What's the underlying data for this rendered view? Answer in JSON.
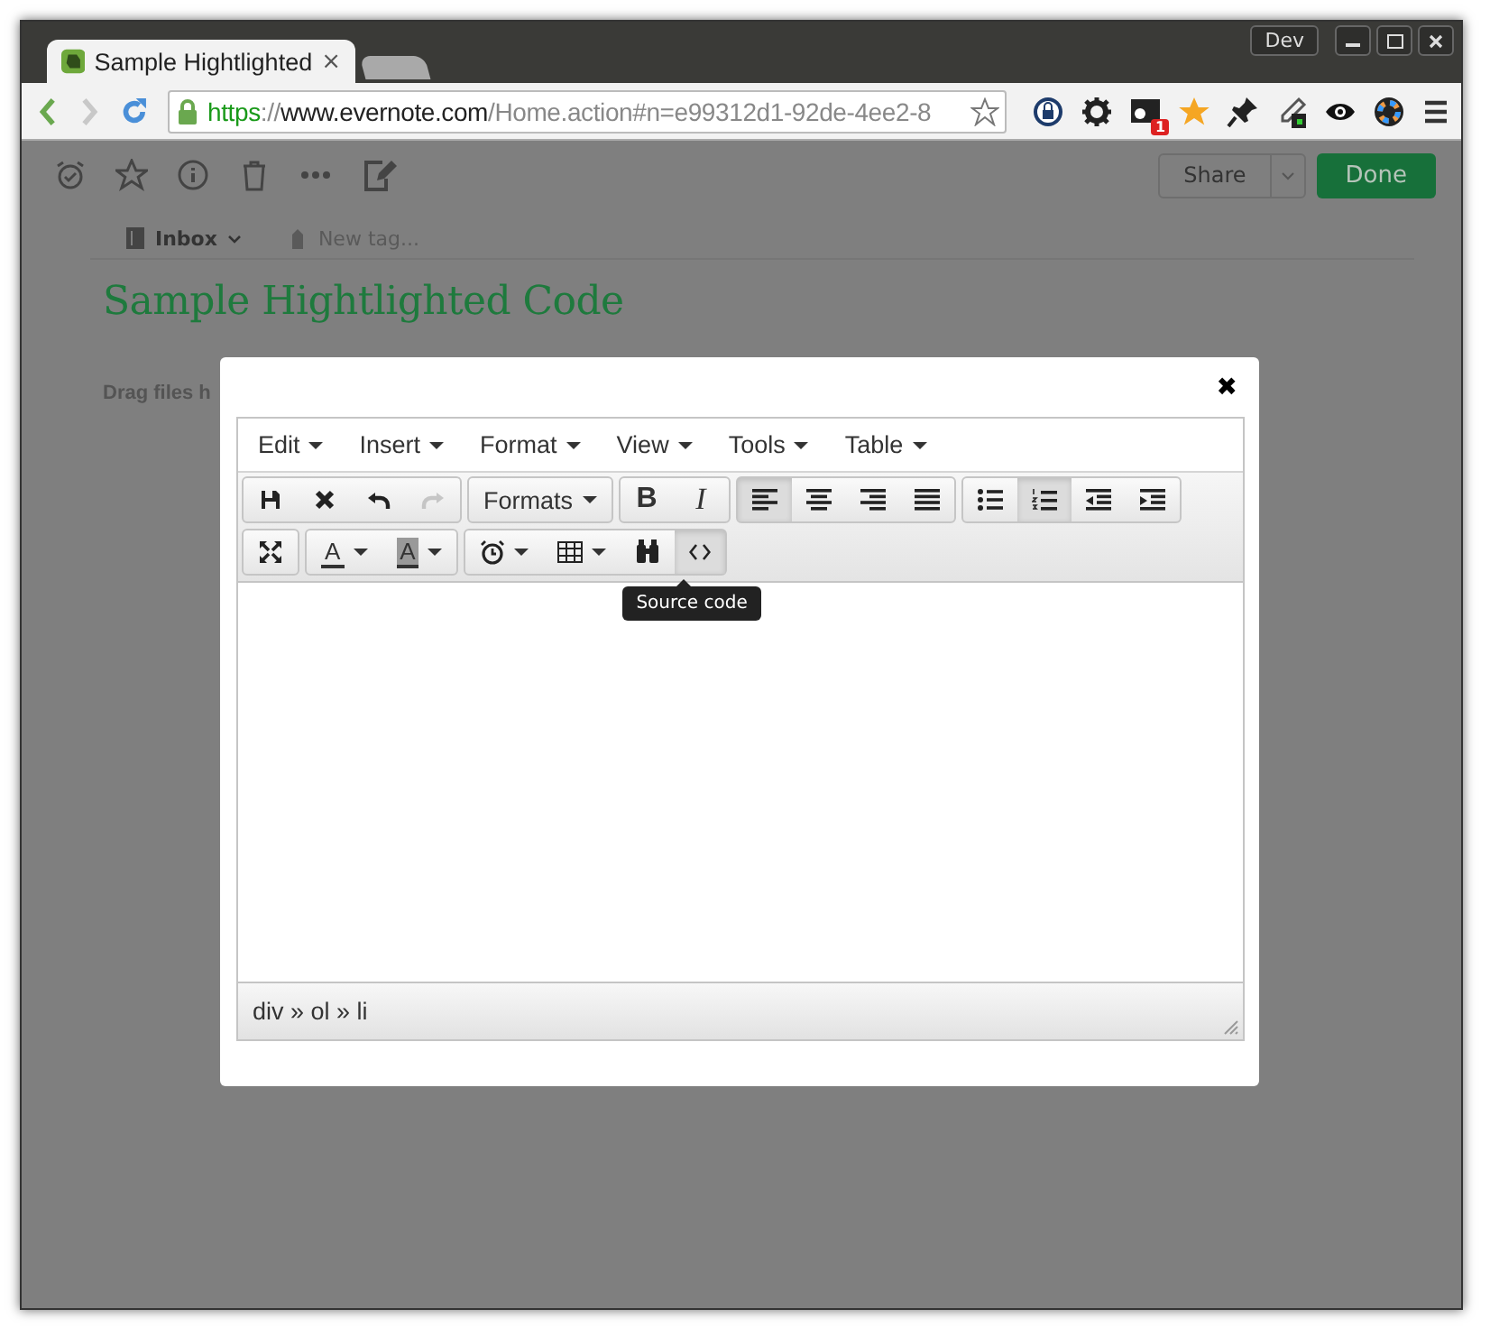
{
  "browser": {
    "profile_button": "Dev",
    "tabs": [
      {
        "title": "Sample Hightlighted",
        "close": "×",
        "selected": true
      },
      {
        "selected": false
      }
    ],
    "url": {
      "scheme": "https",
      "separator": "://",
      "host": "www.evernote.com",
      "rest": "/Home.action#n=e99312d1-92de-4ee2-8"
    },
    "extension_badge": "1"
  },
  "note_toolbar": {
    "share": "Share",
    "done": "Done"
  },
  "note": {
    "notebook": "Inbox",
    "tag_placeholder": "New tag...",
    "title": "Sample Hightlighted Code",
    "drop_hint": "Drag files h"
  },
  "dialog": {
    "close": "✖",
    "menus": [
      "Edit",
      "Insert",
      "Format",
      "View",
      "Tools",
      "Table"
    ],
    "toolbar_rows": [
      [
        [
          {
            "kind": "save",
            "selected": false,
            "disabled": false
          },
          {
            "kind": "cancel",
            "selected": false,
            "disabled": false
          },
          {
            "kind": "undo",
            "selected": false,
            "disabled": false
          },
          {
            "kind": "redo",
            "selected": false,
            "disabled": true
          }
        ],
        [
          {
            "kind": "dropdown",
            "label": "Formats",
            "selected": false,
            "disabled": false
          }
        ],
        [
          {
            "kind": "bold",
            "label": "B",
            "selected": false,
            "disabled": false
          },
          {
            "kind": "italic",
            "label": "I",
            "selected": false,
            "disabled": false
          }
        ],
        [
          {
            "kind": "alignleft",
            "selected": true,
            "disabled": false
          },
          {
            "kind": "aligncenter",
            "selected": false,
            "disabled": false
          },
          {
            "kind": "alignright",
            "selected": false,
            "disabled": false
          },
          {
            "kind": "alignjustify",
            "selected": false,
            "disabled": false
          }
        ],
        [
          {
            "kind": "bullist",
            "selected": false,
            "disabled": false
          },
          {
            "kind": "numlist",
            "selected": true,
            "disabled": false
          },
          {
            "kind": "outdent",
            "selected": false,
            "disabled": false
          },
          {
            "kind": "indent",
            "selected": false,
            "disabled": false
          }
        ]
      ],
      [
        [
          {
            "kind": "fullscreen",
            "selected": false,
            "disabled": false
          }
        ],
        [
          {
            "kind": "forecolor",
            "label": "A",
            "selected": false,
            "disabled": false
          },
          {
            "kind": "backcolor",
            "label": "A",
            "selected": false,
            "disabled": false
          }
        ],
        [
          {
            "kind": "alarm",
            "selected": false,
            "disabled": false
          },
          {
            "kind": "table",
            "selected": false,
            "disabled": false
          },
          {
            "kind": "search",
            "selected": false,
            "disabled": false
          },
          {
            "kind": "code",
            "selected": true,
            "disabled": false
          }
        ]
      ]
    ],
    "tooltip": "Source code",
    "path": "div » ol » li"
  }
}
